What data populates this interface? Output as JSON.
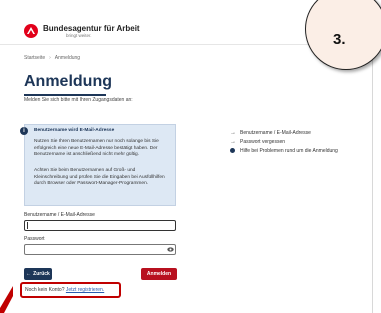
{
  "header": {
    "brand_name": "Bundesagentur für Arbeit",
    "brand_tagline": "bringt weiter."
  },
  "breadcrumb": [
    "Startseite",
    "Anmeldung"
  ],
  "page": {
    "title": "Anmeldung",
    "intro": "Melden Sie sich bitte mit Ihren Zugangsdaten an:"
  },
  "infobox": {
    "title": "Benutzername wird E-Mail-Adresse",
    "paragraph1": "Nutzen Sie Ihren Benutzernamen nur noch solange bis Sie erfolgreich eine neue E-Mail-Adresse bestätigt haben. Der Benutzername ist anschließend nicht mehr gültig.",
    "paragraph2": "Achten Sie beim Benutzernamen auf Groß- und Kleinschreibung und prüfen Sie die Eingaben bei Ausfüllhilfen durch Browser oder Passwort-Manager-Programmen."
  },
  "aside": {
    "link_username": "Benutzername / E-Mail-Adresse",
    "link_forgot": "Passwort vergessen",
    "link_help": "Hilfe bei Problemen rund um die Anmeldung"
  },
  "form": {
    "username_label": "Benutzername / E-Mail-Adresse",
    "username_value": "",
    "password_label": "Passwort",
    "password_value": ""
  },
  "buttons": {
    "back": "Zurück",
    "back_arrow": "←",
    "login": "Anmelden"
  },
  "register": {
    "prefix": "Noch kein Konto?",
    "link": "Jetzt registrieren."
  },
  "annotation": {
    "step": "3.",
    "highlight_color": "#c00000"
  },
  "colors": {
    "brand_red": "#e2001a",
    "navy": "#1d3658",
    "login_red": "#b8101f",
    "info_bg": "#dde8f4"
  }
}
